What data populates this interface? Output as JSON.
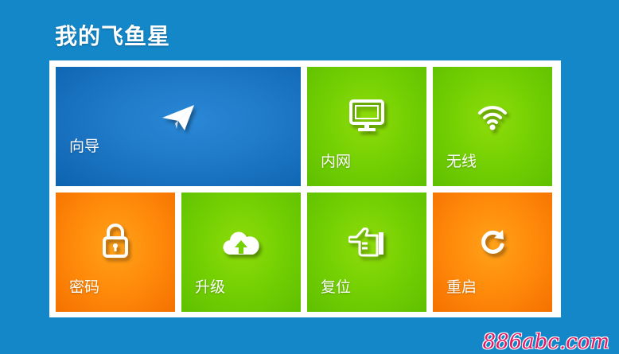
{
  "header": {
    "title": "我的飞鱼星"
  },
  "tiles": {
    "wizard": {
      "label": "向导",
      "icon": "paper-plane-icon",
      "color": "#1f79c7"
    },
    "lan": {
      "label": "内网",
      "icon": "monitor-icon",
      "color": "#76d103"
    },
    "wireless": {
      "label": "无线",
      "icon": "wifi-icon",
      "color": "#76d103"
    },
    "password": {
      "label": "密码",
      "icon": "padlock-icon",
      "color": "#ff8a0a"
    },
    "upgrade": {
      "label": "升级",
      "icon": "cloud-upload-icon",
      "color": "#76d103"
    },
    "reset": {
      "label": "复位",
      "icon": "pointing-hand-icon",
      "color": "#76d103"
    },
    "reboot": {
      "label": "重启",
      "icon": "refresh-icon",
      "color": "#ff8a0a"
    }
  },
  "colors": {
    "background": "#1387c8",
    "panel": "#ffffff",
    "blue_tile": "#1f79c7",
    "green_tile": "#76d103",
    "orange_tile": "#ff8a0a"
  },
  "watermark": {
    "text": "886abc.com"
  }
}
